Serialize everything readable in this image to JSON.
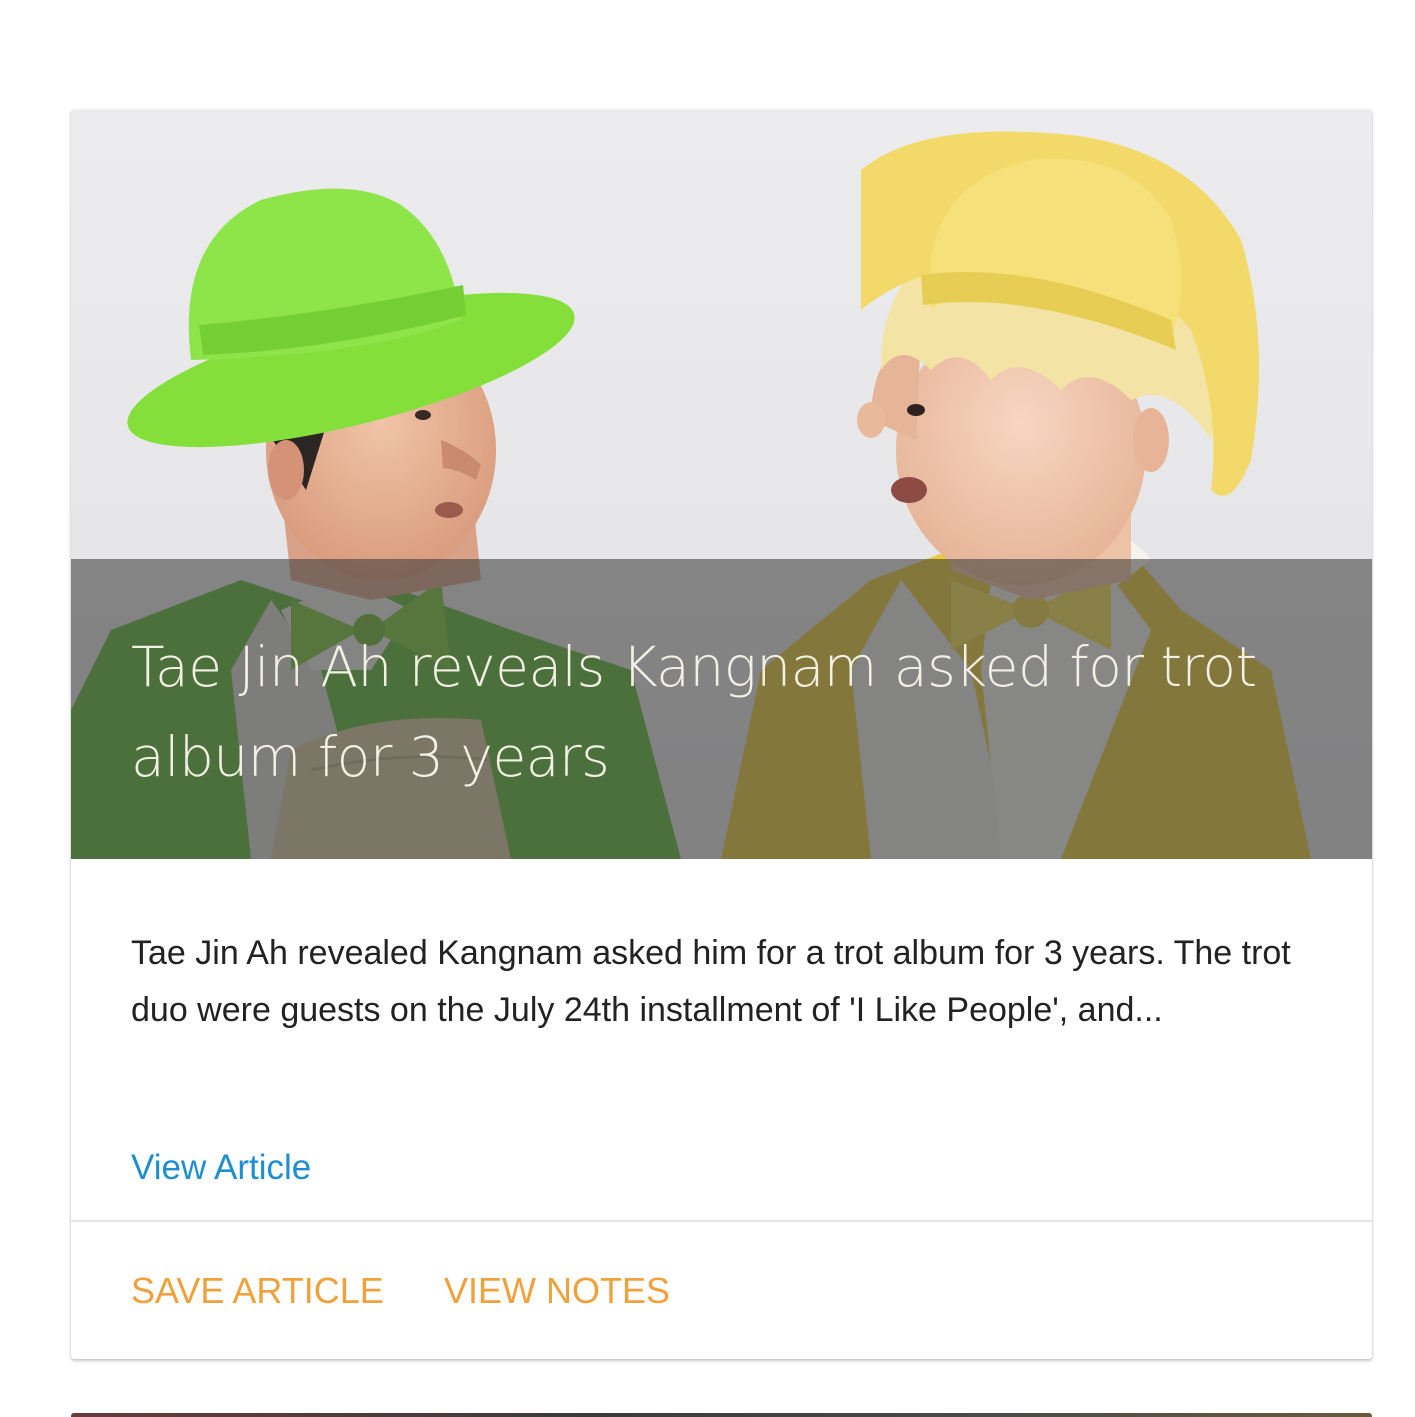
{
  "card": {
    "title": "Tae Jin Ah reveals Kangnam asked for trot album for 3 years",
    "summary": "Tae Jin Ah revealed Kangnam asked him for a trot album for 3 years. The trot duo were guests on the July 24th installment of 'I Like People', and...",
    "view_article_label": "View Article",
    "actions": {
      "save_label": "SAVE ARTICLE",
      "notes_label": "VIEW NOTES"
    }
  },
  "colors": {
    "accent_orange": "#f0a13c",
    "link_blue": "#1e8ed2",
    "green_hat": "#7fdc3a",
    "yellow_hat": "#f2d96a"
  }
}
